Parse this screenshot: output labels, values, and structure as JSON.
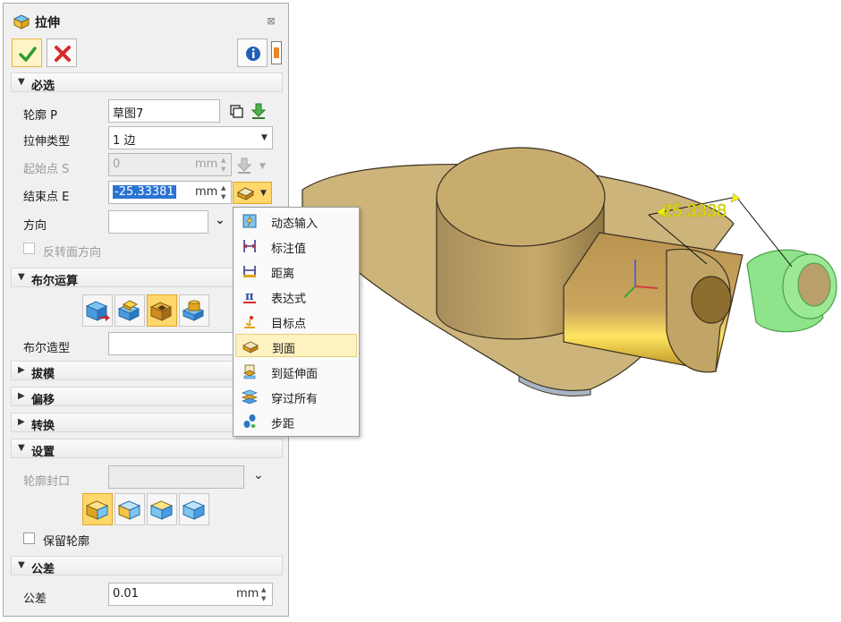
{
  "dialog": {
    "title": "拉伸",
    "ok_icon": "check-icon",
    "cancel_icon": "x-icon",
    "info_icon": "info-icon"
  },
  "required": {
    "header": "必选",
    "profile_label": "轮廓 P",
    "profile_value": "草图7",
    "extrude_type_label": "拉伸类型",
    "extrude_type_value": "1 边",
    "start_label": "起始点 S",
    "start_value": "0",
    "start_unit": "mm",
    "end_label": "结束点 E",
    "end_value": "-25.33381",
    "end_unit": "mm",
    "direction_label": "方向",
    "direction_value": "",
    "reverse_label": "反转面方向"
  },
  "boolean": {
    "header": "布尔运算",
    "shape_label": "布尔造型",
    "shape_value": "",
    "active_index": 2
  },
  "collapsed_sections": [
    "拔模",
    "偏移",
    "转换"
  ],
  "settings": {
    "header": "设置",
    "cap_label": "轮廓封口",
    "cap_value": "",
    "keep_profile_label": "保留轮廓"
  },
  "tolerance": {
    "header": "公差",
    "label": "公差",
    "value": "0.01",
    "unit": "mm"
  },
  "menu": {
    "highlighted_index": 5,
    "items": [
      {
        "label": "动态输入",
        "icon": "dynamic-input-icon"
      },
      {
        "label": "标注值",
        "icon": "dimension-value-icon"
      },
      {
        "label": "距离",
        "icon": "distance-icon"
      },
      {
        "label": "表达式",
        "icon": "pi-expression-icon"
      },
      {
        "label": "目标点",
        "icon": "target-point-icon"
      },
      {
        "label": "到面",
        "icon": "to-face-icon"
      },
      {
        "label": "到延伸面",
        "icon": "to-extended-face-icon"
      },
      {
        "label": "穿过所有",
        "icon": "through-all-icon"
      },
      {
        "label": "步距",
        "icon": "step-icon"
      }
    ]
  },
  "viewport": {
    "dimension_text": "25.3338",
    "colors": {
      "part": "#c8aa6a",
      "highlight": "#7fd57a",
      "dimension": "#f2f000"
    }
  }
}
